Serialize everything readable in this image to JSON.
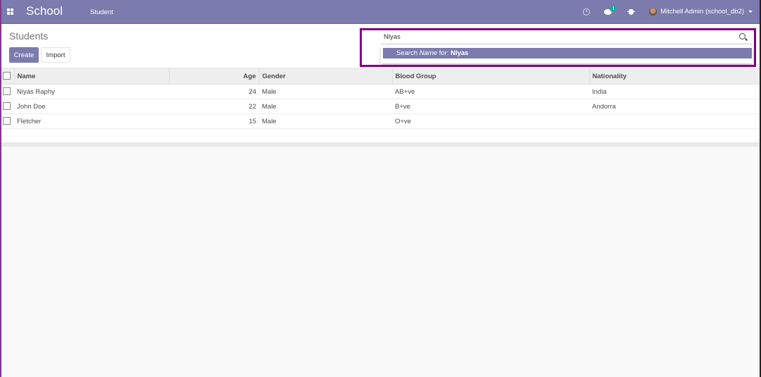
{
  "navbar": {
    "brand": "School",
    "menu_items": [
      "Student"
    ],
    "messages_badge": "1",
    "user_label": "Mitchell Admin (school_db2)",
    "accent_color": "#7c7bad"
  },
  "control_panel": {
    "breadcrumb": "Students",
    "create_label": "Create",
    "import_label": "Import"
  },
  "search": {
    "value": "Nlyas",
    "autocomplete": {
      "prefix": "Search ",
      "field": "Name",
      "middle": " for: ",
      "term": "Nlyas"
    },
    "highlight_color": "#800080"
  },
  "table": {
    "columns": [
      "Name",
      "Age",
      "Gender",
      "Blood Group",
      "Nationality"
    ],
    "rows": [
      {
        "name": "Niyas Raphy",
        "age": "24",
        "gender": "Male",
        "blood_group": "AB+ve",
        "nationality": "India"
      },
      {
        "name": "John Doe",
        "age": "22",
        "gender": "Male",
        "blood_group": "B+ve",
        "nationality": "Andorra"
      },
      {
        "name": "Fletcher",
        "age": "15",
        "gender": "Male",
        "blood_group": "O+ve",
        "nationality": ""
      }
    ]
  }
}
